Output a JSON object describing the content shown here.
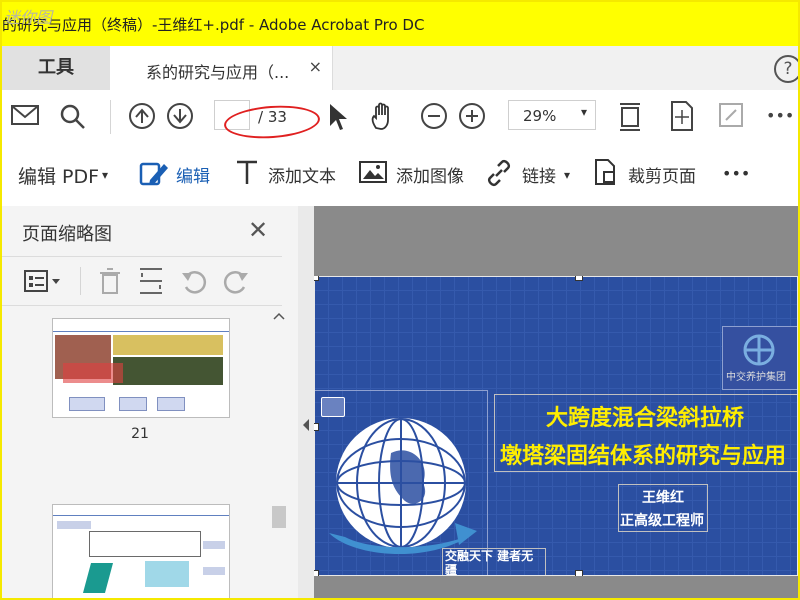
{
  "window": {
    "title": "的研究与应用（终稿）-王维红+.pdf - Adobe Acrobat Pro DC",
    "watermark": "迷你图"
  },
  "tabs": {
    "tools_label": "工具",
    "document_label": "系的研究与应用（...",
    "close_symbol": "×",
    "help_symbol": "?"
  },
  "toolbar": {
    "page_current": "",
    "page_total": "/ 33",
    "zoom_value": "29%",
    "zoom_caret": "▾",
    "more": "•••"
  },
  "edit_toolbar": {
    "edit_pdf_label": "编辑 PDF",
    "edit_pdf_caret": "▾",
    "edit_label": "编辑",
    "add_text_label": "添加文本",
    "add_image_label": "添加图像",
    "link_label": "链接",
    "link_caret": "▾",
    "crop_label": "裁剪页面",
    "more": "•••"
  },
  "thumbnail_panel": {
    "title": "页面缩略图",
    "close_symbol": "✕",
    "pages": [
      {
        "number": "21"
      },
      {
        "number": ""
      }
    ]
  },
  "document": {
    "slide_title_line1": "大跨度混合梁斜拉桥",
    "slide_title_line2": "墩塔梁固结体系的研究与应用",
    "author_name": "王维红",
    "author_title": "正高级工程师",
    "slogan": "交融天下  建者无疆",
    "logo_caption": "中交养护集团"
  },
  "colors": {
    "title_bar": "#ffff00",
    "slide_background": "#2b4fa1",
    "slide_title": "#ffee00",
    "annotation_oval": "#e02020",
    "edit_accent": "#1a5fb4"
  }
}
